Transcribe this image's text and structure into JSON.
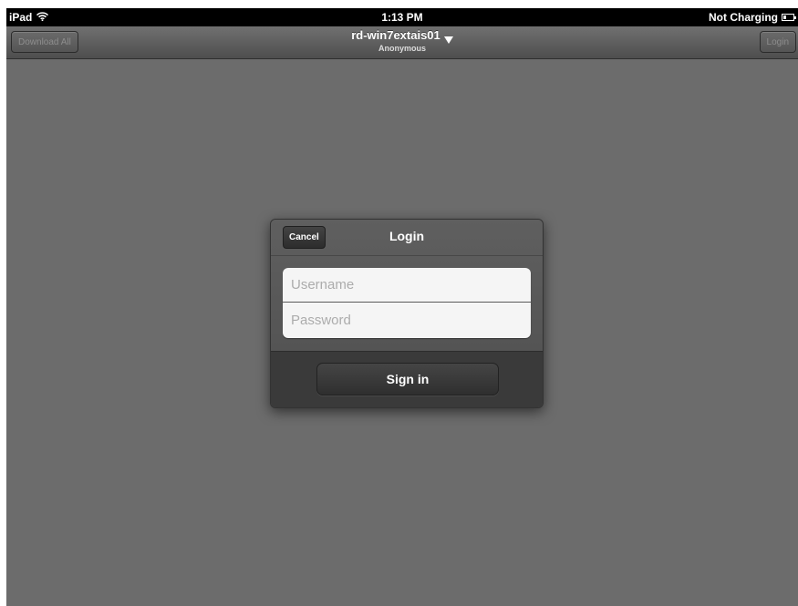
{
  "status_bar": {
    "device": "iPad",
    "wifi_icon": "wifi-icon",
    "time": "1:13 PM",
    "charging": "Not Charging",
    "battery_icon": "battery-icon"
  },
  "nav_bar": {
    "download_all_label": "Download All",
    "title": "rd-win7extais01",
    "subtitle": "Anonymous",
    "title_menu_icon": "chevron-down-icon",
    "login_label": "Login"
  },
  "login_dialog": {
    "title": "Login",
    "cancel_label": "Cancel",
    "username_placeholder": "Username",
    "username_value": "",
    "password_placeholder": "Password",
    "password_value": "",
    "sign_in_label": "Sign in"
  },
  "colors": {
    "background": "#6c6c6c",
    "status_bar": "#000000",
    "nav_bar": "#5e5e5e",
    "dialog": "#5b5b5b",
    "dialog_footer": "#3a3a3a",
    "field_background": "#f5f5f5"
  }
}
